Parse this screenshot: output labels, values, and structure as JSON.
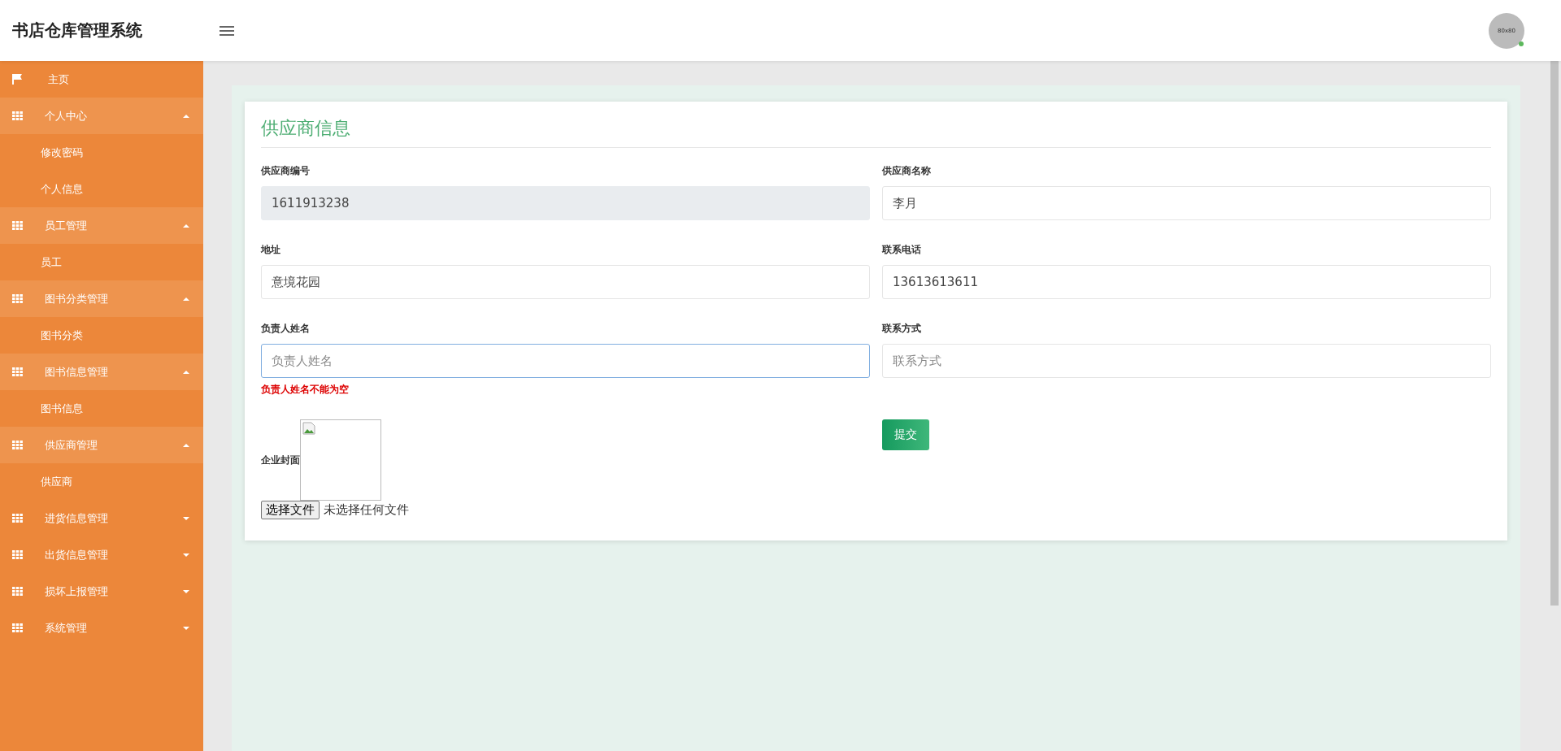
{
  "header": {
    "title": "书店仓库管理系统",
    "avatar_text": "80x80",
    "online": true
  },
  "sidebar": {
    "items": [
      {
        "kind": "link",
        "label": "主页"
      },
      {
        "kind": "group",
        "label": "个人中心",
        "expanded": true,
        "children": [
          {
            "label": "修改密码"
          },
          {
            "label": "个人信息"
          }
        ]
      },
      {
        "kind": "group",
        "label": "员工管理",
        "expanded": true,
        "children": [
          {
            "label": "员工"
          }
        ]
      },
      {
        "kind": "group",
        "label": "图书分类管理",
        "expanded": true,
        "children": [
          {
            "label": "图书分类"
          }
        ]
      },
      {
        "kind": "group",
        "label": "图书信息管理",
        "expanded": true,
        "children": [
          {
            "label": "图书信息"
          }
        ]
      },
      {
        "kind": "group",
        "label": "供应商管理",
        "expanded": true,
        "children": [
          {
            "label": "供应商"
          }
        ]
      },
      {
        "kind": "group",
        "label": "进货信息管理",
        "expanded": false
      },
      {
        "kind": "group",
        "label": "出货信息管理",
        "expanded": false
      },
      {
        "kind": "group",
        "label": "损坏上报管理",
        "expanded": false
      },
      {
        "kind": "group",
        "label": "系统管理",
        "expanded": false
      }
    ]
  },
  "form": {
    "title": "供应商信息",
    "fields": [
      {
        "label": "供应商编号",
        "value": "1611913238",
        "disabled": true,
        "focused": false
      },
      {
        "label": "供应商名称",
        "value": "李月",
        "disabled": false,
        "focused": false
      },
      {
        "label": "地址",
        "value": "意境花园",
        "disabled": false,
        "focused": false
      },
      {
        "label": "联系电话",
        "value": "13613613611",
        "disabled": false,
        "focused": false
      },
      {
        "label": "负责人姓名",
        "placeholder": "负责人姓名",
        "disabled": false,
        "focused": true,
        "error": "负责人姓名不能为空"
      },
      {
        "label": "联系方式",
        "placeholder": "联系方式",
        "disabled": false,
        "focused": false
      }
    ],
    "cover": {
      "label": "企业封面",
      "file_button": "选择文件",
      "file_status": "未选择任何文件"
    },
    "submit": "提交"
  }
}
